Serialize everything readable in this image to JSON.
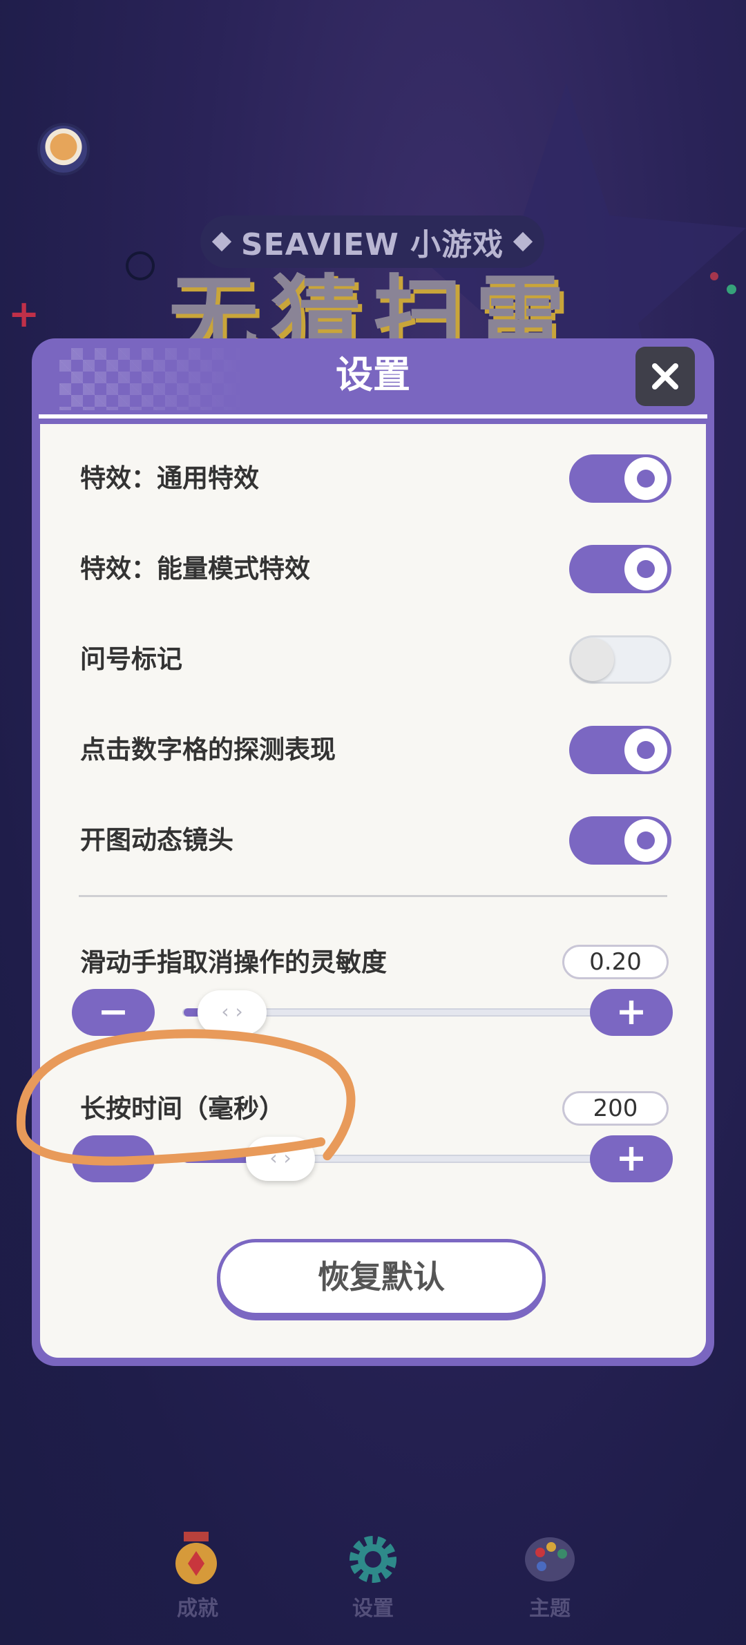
{
  "header": {
    "game_tag": "SEAVIEW 小游戏",
    "game_title": "无猜扫雷"
  },
  "dialog": {
    "title": "设置",
    "close_icon": "close-icon",
    "toggles": [
      {
        "label": "特效：通用特效",
        "on": true
      },
      {
        "label": "特效：能量模式特效",
        "on": true
      },
      {
        "label": "问号标记",
        "on": false
      },
      {
        "label": "点击数字格的探测表现",
        "on": true
      },
      {
        "label": "开图动态镜头",
        "on": true
      }
    ],
    "sliders": [
      {
        "label": "滑动手指取消操作的灵敏度",
        "value": "0.20",
        "minus": "−",
        "plus": "+",
        "thumb": "‹ ›"
      },
      {
        "label": "长按时间（毫秒）",
        "value": "200",
        "minus": "−",
        "plus": "+",
        "thumb": "‹ ›"
      }
    ],
    "reset_label": "恢复默认"
  },
  "bottom_nav": [
    {
      "label": "成就",
      "icon": "medal-icon"
    },
    {
      "label": "设置",
      "icon": "gear-icon"
    },
    {
      "label": "主题",
      "icon": "palette-icon"
    }
  ],
  "colors": {
    "accent": "#7b67c2",
    "background": "#262153",
    "annotation": "#e89a5a"
  }
}
